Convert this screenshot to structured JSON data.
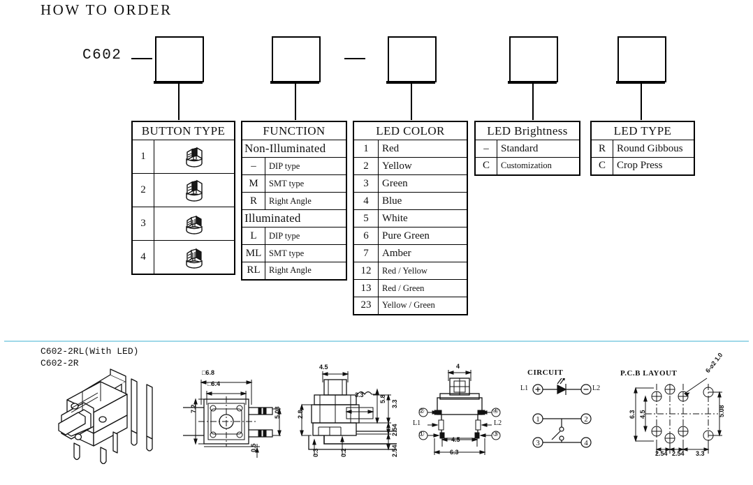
{
  "page": {
    "title": "HOW TO ORDER",
    "code_prefix": "C602"
  },
  "selector_boxes": [
    {
      "name": "button-type"
    },
    {
      "name": "function"
    },
    {
      "name": "led-color"
    },
    {
      "name": "led-brightness"
    },
    {
      "name": "led-type"
    }
  ],
  "tables": {
    "button_type": {
      "header": "BUTTON TYPE",
      "rows": [
        {
          "key": "1",
          "icon": "button-cap-icon"
        },
        {
          "key": "2",
          "icon": "button-cap-icon"
        },
        {
          "key": "3",
          "icon": "button-cap-icon"
        },
        {
          "key": "4",
          "icon": "button-cap-icon"
        }
      ]
    },
    "function": {
      "header": "FUNCTION",
      "groups": [
        {
          "label": "Non-Illuminated",
          "rows": [
            {
              "key": "–",
              "value": "DIP type"
            },
            {
              "key": "M",
              "value": "SMT type"
            },
            {
              "key": "R",
              "value": "Right Angle"
            }
          ]
        },
        {
          "label": "Illuminated",
          "rows": [
            {
              "key": "L",
              "value": "DIP type"
            },
            {
              "key": "ML",
              "value": "SMT type"
            },
            {
              "key": "RL",
              "value": "Right Angle"
            }
          ]
        }
      ]
    },
    "led_color": {
      "header": "LED COLOR",
      "rows": [
        {
          "key": "1",
          "value": "Red",
          "small": false
        },
        {
          "key": "2",
          "value": "Yellow",
          "small": false
        },
        {
          "key": "3",
          "value": "Green",
          "small": false
        },
        {
          "key": "4",
          "value": "Blue",
          "small": false
        },
        {
          "key": "5",
          "value": "White",
          "small": false
        },
        {
          "key": "6",
          "value": "Pure Green",
          "small": false
        },
        {
          "key": "7",
          "value": "Amber",
          "small": false
        },
        {
          "key": "12",
          "value": "Red / Yellow",
          "small": true
        },
        {
          "key": "13",
          "value": "Red / Green",
          "small": true
        },
        {
          "key": "23",
          "value": "Yellow / Green",
          "small": true
        }
      ]
    },
    "led_brightness": {
      "header": "LED Brightness",
      "rows": [
        {
          "key": "–",
          "value": "Standard",
          "small": false
        },
        {
          "key": "C",
          "value": "Customization",
          "small": true
        }
      ]
    },
    "led_type": {
      "header": "LED TYPE",
      "rows": [
        {
          "key": "R",
          "value": "Round Gibbous",
          "small": false
        },
        {
          "key": "C",
          "value": "Crop Press",
          "small": false
        }
      ]
    }
  },
  "drawings": {
    "part_labels": [
      "C602-2RL(With LED)",
      "C602-2R"
    ],
    "isometric": {
      "name": "isometric-switch-view"
    },
    "top_view": {
      "dims": {
        "outer_square": "□6.8",
        "inner_square": "□6.4",
        "height": "7.2",
        "pitch": "5.08",
        "lead": "0.5"
      }
    },
    "side_view": {
      "dims": {
        "cap_width": "4.5",
        "body_h": "2.8",
        "tab": "3.3",
        "total_h": "5.8",
        "right_h": "3.3",
        "pitch_a": "2.54",
        "pitch_b": "2.54",
        "lead_a": "0.3",
        "lead_b": "0.2"
      }
    },
    "front_view": {
      "dims": {
        "cap": "4",
        "inner": "4.5",
        "outer": "6.3"
      },
      "terminals": [
        "②",
        "④",
        "L1",
        "L2",
        "①",
        "③"
      ]
    },
    "circuit": {
      "title": "CIRCUIT",
      "led_left": "L1",
      "led_right": "L2",
      "pins": [
        "①",
        "②",
        "③",
        "④"
      ]
    },
    "pcb_layout": {
      "title": "P.C.B LAYOUT",
      "hole_note": "6-⌀2 1.0",
      "dims": {
        "outer_h": "6.3",
        "inner_h": "4.5",
        "right_h": "5.08",
        "p1": "2.54",
        "p2": "2.54",
        "p3": "3.3"
      }
    }
  },
  "colors": {
    "line": "#000000",
    "separator": "#9fd8e8",
    "background": "#ffffff"
  }
}
